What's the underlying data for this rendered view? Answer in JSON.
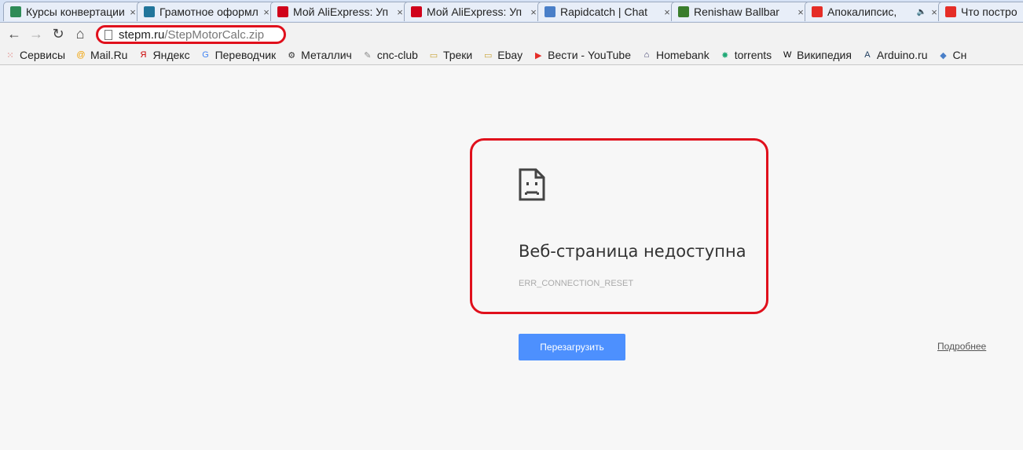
{
  "tabs": [
    {
      "title": "Курсы конвертации",
      "icon": "compass-icon",
      "color": "#2e8b57"
    },
    {
      "title": "Грамотное оформление",
      "icon": "wordpress-icon",
      "color": "#21759b"
    },
    {
      "title": "Мой AliExpress: Уп",
      "icon": "aliexpress-cart-icon",
      "color": "#d0021b"
    },
    {
      "title": "Мой AliExpress: Уп",
      "icon": "aliexpress-cart-icon",
      "color": "#d0021b"
    },
    {
      "title": "Rapidcatch | Chat",
      "icon": "puzzle-icon",
      "color": "#4a7fc8"
    },
    {
      "title": "Renishaw Ballbar",
      "icon": "tv-test-pattern-icon",
      "color": "#3a7d2c"
    },
    {
      "title": "Апокалипсис, ",
      "icon": "youtube-icon",
      "color": "#e52d27",
      "audio": "🔈"
    },
    {
      "title": "Что постро",
      "icon": "youtube-icon",
      "color": "#e52d27"
    }
  ],
  "toolbar": {
    "back": "←",
    "forward": "→",
    "reload": "↻",
    "home": "⌂",
    "url_host": "stepm.ru",
    "url_path": "/StepMotorCalc.zip"
  },
  "bookmarks": [
    {
      "label": "Сервисы",
      "icon": "apps-grid-icon"
    },
    {
      "label": "Mail.Ru",
      "icon": "mailru-icon"
    },
    {
      "label": "Яндекс",
      "icon": "yandex-icon"
    },
    {
      "label": "Переводчик",
      "icon": "google-translate-icon"
    },
    {
      "label": "Металлич",
      "icon": "gear-icon"
    },
    {
      "label": "cnc-club",
      "icon": "cnc-club-icon"
    },
    {
      "label": "Треки",
      "icon": "folder-icon"
    },
    {
      "label": "Ebay",
      "icon": "folder-icon"
    },
    {
      "label": "Вести - YouTube",
      "icon": "youtube-icon"
    },
    {
      "label": "Homebank",
      "icon": "house-icon"
    },
    {
      "label": "torrents",
      "icon": "sparkle-icon"
    },
    {
      "label": "Википедия",
      "icon": "wikipedia-icon"
    },
    {
      "label": "Arduino.ru",
      "icon": "arduino-icon"
    },
    {
      "label": "Сн",
      "icon": "puzzle-icon"
    }
  ],
  "error": {
    "title": "Веб-страница недоступна",
    "code": "ERR_CONNECTION_RESET",
    "reload_label": "Перезагрузить",
    "details_label": "Подробнее"
  },
  "colors": {
    "highlight": "#e0101c",
    "button": "#4d90fe"
  }
}
